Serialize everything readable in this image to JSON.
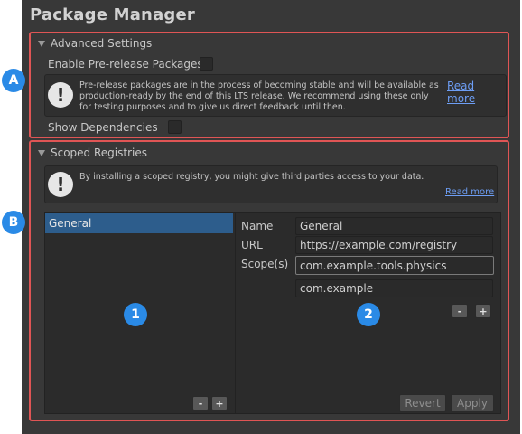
{
  "window": {
    "title": "Package Manager"
  },
  "callouts": {
    "a": "A",
    "b": "B",
    "one": "1",
    "two": "2"
  },
  "advanced": {
    "header": "Advanced Settings",
    "prerelease_label": "Enable Pre-release Packages",
    "prerelease_checked": false,
    "help_lines": [
      "Pre-release packages are in the process of becoming stable and will be available as",
      "production-ready by the end of this LTS release. We recommend using these only",
      "for testing purposes and to give us direct feedback until then."
    ],
    "read_more": "Read more",
    "show_deps_label": "Show Dependencies",
    "show_deps_checked": false
  },
  "scoped": {
    "header": "Scoped Registries",
    "help_text": "By installing a scoped registry, you might give third parties access to your data.",
    "read_more": "Read more",
    "registries": [
      "General"
    ],
    "selected": "General",
    "list_remove": "-",
    "list_add": "+",
    "form": {
      "name_label": "Name",
      "name_value": "General",
      "url_label": "URL",
      "url_value": "https://example.com/registry",
      "scopes_label": "Scope(s)",
      "scopes": [
        "com.example.tools.physics",
        "com.example"
      ],
      "scope_remove": "-",
      "scope_add": "+"
    },
    "revert_label": "Revert",
    "apply_label": "Apply"
  },
  "colors": {
    "accent_link": "#6d9ef5",
    "selection": "#2d5d8c",
    "annotation_border": "#e05555",
    "callout": "#2a8ae6"
  }
}
